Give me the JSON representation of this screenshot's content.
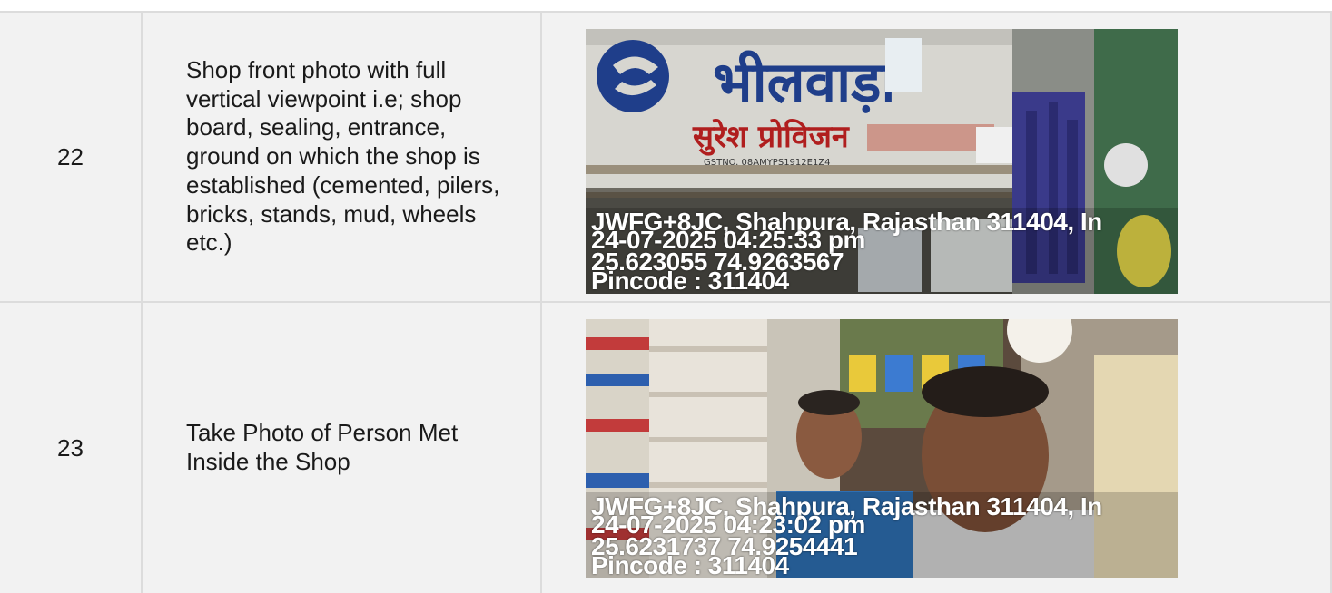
{
  "rows": [
    {
      "number": "22",
      "description": "Shop front photo with full vertical viewpoint i.e; shop board, sealing, entrance, ground on which the shop is established (cemented, pilers, bricks, stands, mud, wheels etc.)",
      "photo": {
        "sign_bank": "भीलवाड़ा",
        "sign_shop": "सुरेश प्रोविजन",
        "sign_gst": "GSTNO. 08AMYPS1912E1Z4",
        "overlay": {
          "address": "JWFG+8JC, Shahpura, Rajasthan 311404, In",
          "datetime": "24-07-2025 04:25:33 pm",
          "coords": "25.623055 74.9263567",
          "pincode": "Pincode : 311404"
        }
      }
    },
    {
      "number": "23",
      "description": "Take Photo of Person Met Inside the Shop",
      "photo": {
        "overlay": {
          "address": "JWFG+8JC, Shahpura, Rajasthan 311404, In",
          "datetime": "24-07-2025 04:23:02 pm",
          "coords": "25.6231737 74.9254441",
          "pincode": "Pincode : 311404"
        }
      }
    }
  ]
}
